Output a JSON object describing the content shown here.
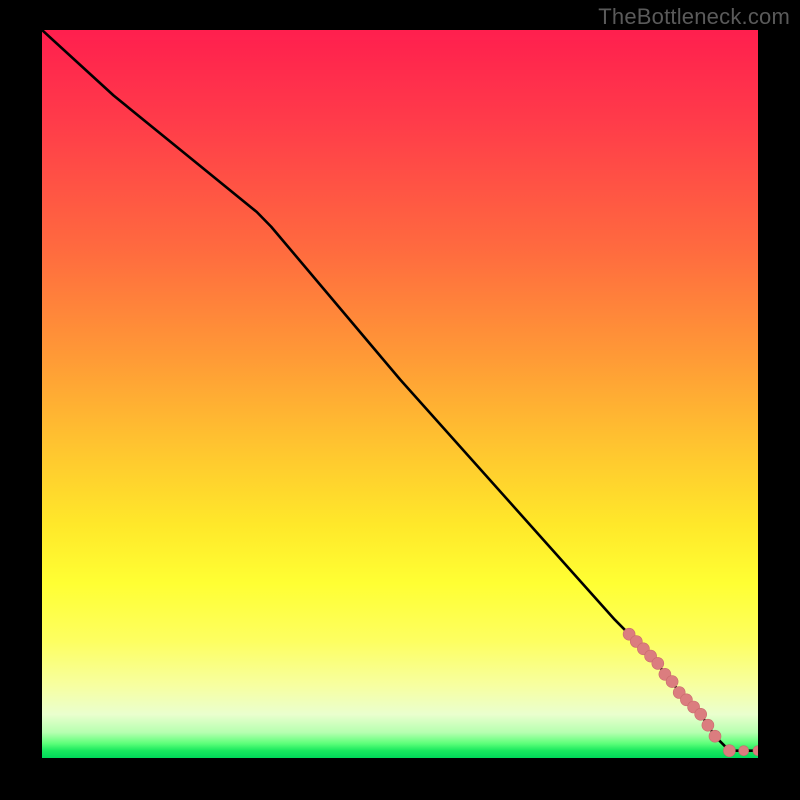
{
  "watermark": "TheBottleneck.com",
  "colors": {
    "line": "#000000",
    "marker_fill": "#db7d7f",
    "marker_stroke": "#c96a6c",
    "background": "#000000"
  },
  "chart_data": {
    "type": "line",
    "title": "",
    "xlabel": "",
    "ylabel": "",
    "xlim": [
      0,
      100
    ],
    "ylim": [
      0,
      100
    ],
    "grid": false,
    "legend": false,
    "series": [
      {
        "name": "curve",
        "x": [
          0,
          10,
          20,
          30,
          32,
          50,
          70,
          80,
          82,
          83,
          84,
          85,
          86,
          87,
          88,
          89,
          90,
          91,
          92,
          93,
          94,
          96,
          98,
          100
        ],
        "values": [
          100,
          91,
          83,
          75,
          73,
          52,
          30,
          19,
          17,
          16,
          15,
          14,
          13,
          11.5,
          10.5,
          9,
          8,
          7,
          6,
          4.5,
          3,
          1,
          1,
          1
        ],
        "marker_mask": [
          0,
          0,
          0,
          0,
          0,
          0,
          0,
          0,
          1,
          1,
          1,
          1,
          1,
          1,
          1,
          1,
          1,
          1,
          1,
          1,
          1,
          1,
          1,
          1
        ],
        "marker_radius_default": 6,
        "marker_radius_override": {
          "22": 5,
          "23": 5
        }
      }
    ],
    "gradient_stops": [
      {
        "pos": 0.0,
        "color": "#ff1f4e"
      },
      {
        "pos": 0.3,
        "color": "#ff6a3f"
      },
      {
        "pos": 0.58,
        "color": "#ffc72f"
      },
      {
        "pos": 0.76,
        "color": "#ffff33"
      },
      {
        "pos": 0.94,
        "color": "#eaffce"
      },
      {
        "pos": 1.0,
        "color": "#00d85a"
      }
    ]
  }
}
